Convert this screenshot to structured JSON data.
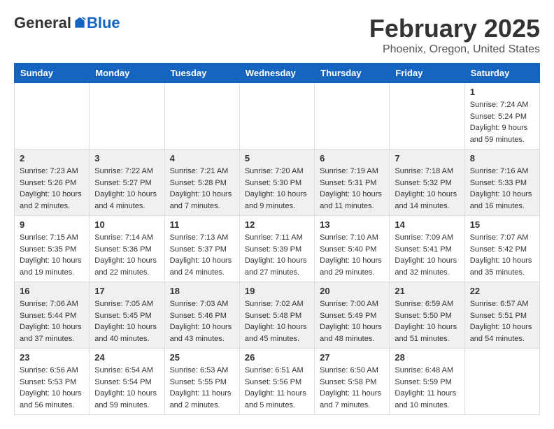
{
  "header": {
    "logo_general": "General",
    "logo_blue": "Blue",
    "month_title": "February 2025",
    "location": "Phoenix, Oregon, United States"
  },
  "days_of_week": [
    "Sunday",
    "Monday",
    "Tuesday",
    "Wednesday",
    "Thursday",
    "Friday",
    "Saturday"
  ],
  "weeks": [
    [
      {
        "day": "",
        "content": ""
      },
      {
        "day": "",
        "content": ""
      },
      {
        "day": "",
        "content": ""
      },
      {
        "day": "",
        "content": ""
      },
      {
        "day": "",
        "content": ""
      },
      {
        "day": "",
        "content": ""
      },
      {
        "day": "1",
        "content": "Sunrise: 7:24 AM\nSunset: 5:24 PM\nDaylight: 9 hours and 59 minutes."
      }
    ],
    [
      {
        "day": "2",
        "content": "Sunrise: 7:23 AM\nSunset: 5:26 PM\nDaylight: 10 hours and 2 minutes."
      },
      {
        "day": "3",
        "content": "Sunrise: 7:22 AM\nSunset: 5:27 PM\nDaylight: 10 hours and 4 minutes."
      },
      {
        "day": "4",
        "content": "Sunrise: 7:21 AM\nSunset: 5:28 PM\nDaylight: 10 hours and 7 minutes."
      },
      {
        "day": "5",
        "content": "Sunrise: 7:20 AM\nSunset: 5:30 PM\nDaylight: 10 hours and 9 minutes."
      },
      {
        "day": "6",
        "content": "Sunrise: 7:19 AM\nSunset: 5:31 PM\nDaylight: 10 hours and 11 minutes."
      },
      {
        "day": "7",
        "content": "Sunrise: 7:18 AM\nSunset: 5:32 PM\nDaylight: 10 hours and 14 minutes."
      },
      {
        "day": "8",
        "content": "Sunrise: 7:16 AM\nSunset: 5:33 PM\nDaylight: 10 hours and 16 minutes."
      }
    ],
    [
      {
        "day": "9",
        "content": "Sunrise: 7:15 AM\nSunset: 5:35 PM\nDaylight: 10 hours and 19 minutes."
      },
      {
        "day": "10",
        "content": "Sunrise: 7:14 AM\nSunset: 5:36 PM\nDaylight: 10 hours and 22 minutes."
      },
      {
        "day": "11",
        "content": "Sunrise: 7:13 AM\nSunset: 5:37 PM\nDaylight: 10 hours and 24 minutes."
      },
      {
        "day": "12",
        "content": "Sunrise: 7:11 AM\nSunset: 5:39 PM\nDaylight: 10 hours and 27 minutes."
      },
      {
        "day": "13",
        "content": "Sunrise: 7:10 AM\nSunset: 5:40 PM\nDaylight: 10 hours and 29 minutes."
      },
      {
        "day": "14",
        "content": "Sunrise: 7:09 AM\nSunset: 5:41 PM\nDaylight: 10 hours and 32 minutes."
      },
      {
        "day": "15",
        "content": "Sunrise: 7:07 AM\nSunset: 5:42 PM\nDaylight: 10 hours and 35 minutes."
      }
    ],
    [
      {
        "day": "16",
        "content": "Sunrise: 7:06 AM\nSunset: 5:44 PM\nDaylight: 10 hours and 37 minutes."
      },
      {
        "day": "17",
        "content": "Sunrise: 7:05 AM\nSunset: 5:45 PM\nDaylight: 10 hours and 40 minutes."
      },
      {
        "day": "18",
        "content": "Sunrise: 7:03 AM\nSunset: 5:46 PM\nDaylight: 10 hours and 43 minutes."
      },
      {
        "day": "19",
        "content": "Sunrise: 7:02 AM\nSunset: 5:48 PM\nDaylight: 10 hours and 45 minutes."
      },
      {
        "day": "20",
        "content": "Sunrise: 7:00 AM\nSunset: 5:49 PM\nDaylight: 10 hours and 48 minutes."
      },
      {
        "day": "21",
        "content": "Sunrise: 6:59 AM\nSunset: 5:50 PM\nDaylight: 10 hours and 51 minutes."
      },
      {
        "day": "22",
        "content": "Sunrise: 6:57 AM\nSunset: 5:51 PM\nDaylight: 10 hours and 54 minutes."
      }
    ],
    [
      {
        "day": "23",
        "content": "Sunrise: 6:56 AM\nSunset: 5:53 PM\nDaylight: 10 hours and 56 minutes."
      },
      {
        "day": "24",
        "content": "Sunrise: 6:54 AM\nSunset: 5:54 PM\nDaylight: 10 hours and 59 minutes."
      },
      {
        "day": "25",
        "content": "Sunrise: 6:53 AM\nSunset: 5:55 PM\nDaylight: 11 hours and 2 minutes."
      },
      {
        "day": "26",
        "content": "Sunrise: 6:51 AM\nSunset: 5:56 PM\nDaylight: 11 hours and 5 minutes."
      },
      {
        "day": "27",
        "content": "Sunrise: 6:50 AM\nSunset: 5:58 PM\nDaylight: 11 hours and 7 minutes."
      },
      {
        "day": "28",
        "content": "Sunrise: 6:48 AM\nSunset: 5:59 PM\nDaylight: 11 hours and 10 minutes."
      },
      {
        "day": "",
        "content": ""
      }
    ]
  ]
}
